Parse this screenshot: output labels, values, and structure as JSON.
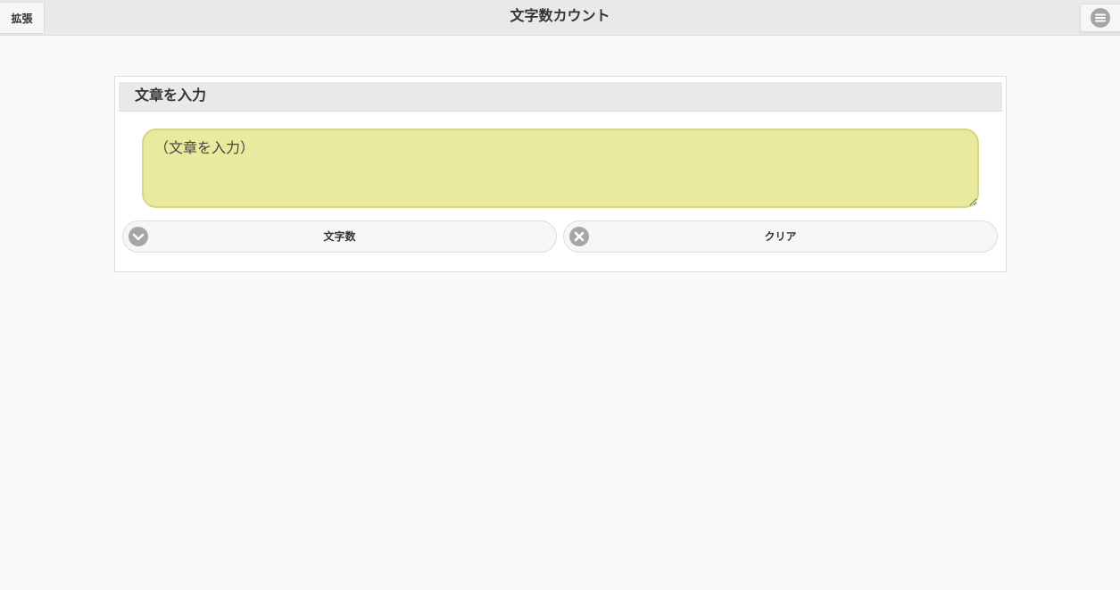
{
  "header": {
    "title": "文字数カウント",
    "left_button": "拡張"
  },
  "panel": {
    "title": "文章を入力",
    "textarea_placeholder": "（文章を入力）",
    "textarea_value": "",
    "count_button": "文字数",
    "clear_button": "クリア"
  },
  "icons": {
    "menu": "hamburger-menu-icon",
    "count": "chevron-down-circle-icon",
    "clear": "close-circle-icon"
  },
  "colors": {
    "textarea_bg": "#e9ea9e",
    "header_bg": "#e9e9e9",
    "icon_gray": "#a6a6a6"
  }
}
